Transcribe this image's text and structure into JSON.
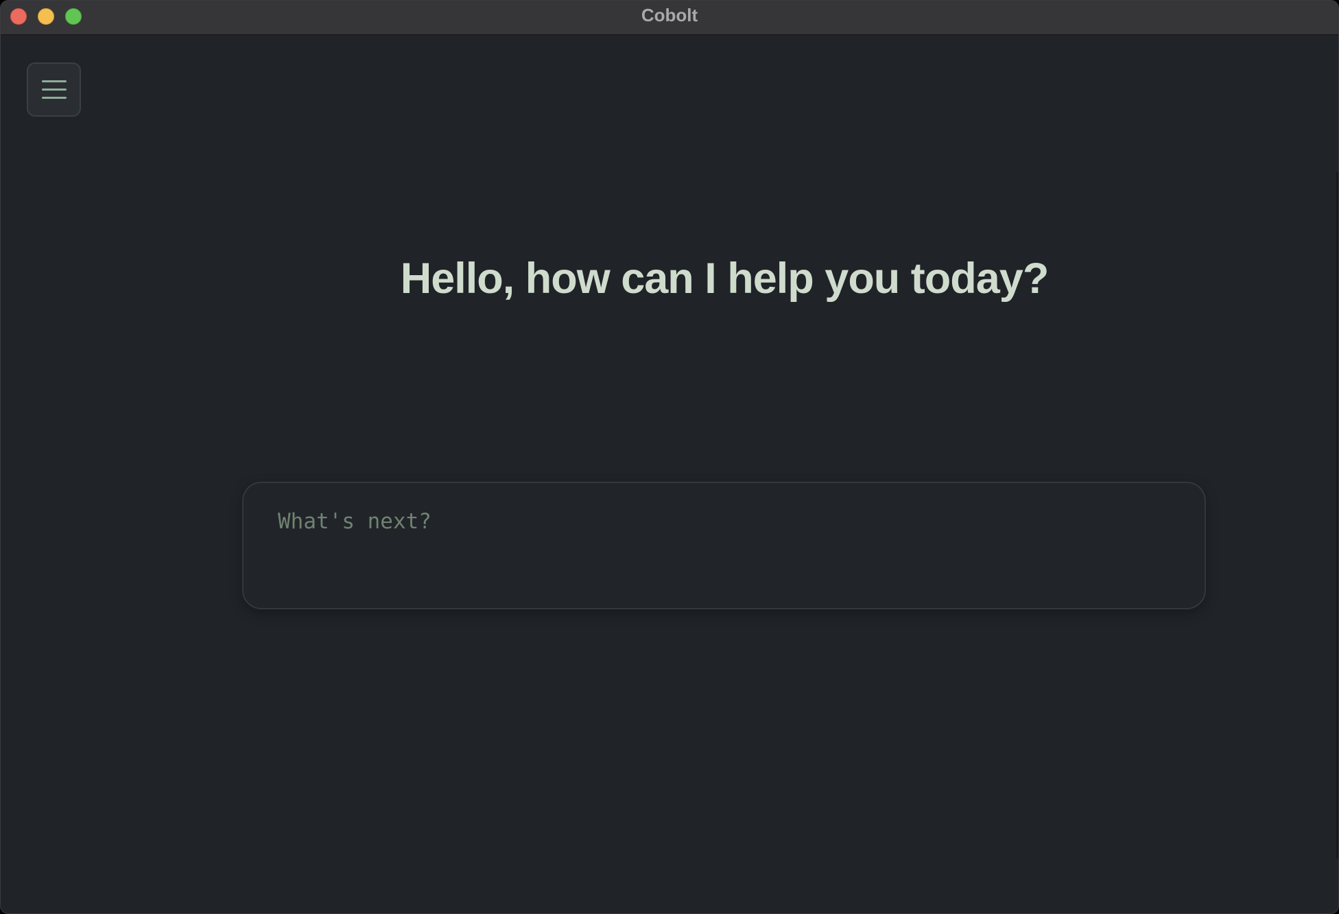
{
  "window": {
    "title": "Cobolt"
  },
  "menu_button": {
    "icon": "hamburger-menu-icon"
  },
  "main": {
    "greeting": "Hello, how can I help you today?",
    "prompt": {
      "placeholder": "What's next?",
      "value": ""
    }
  },
  "colors": {
    "background": "#202327",
    "titlebar": "#363638",
    "accent_text": "#cfdccd",
    "placeholder_text": "#6f8271",
    "icon": "#8fae98"
  }
}
